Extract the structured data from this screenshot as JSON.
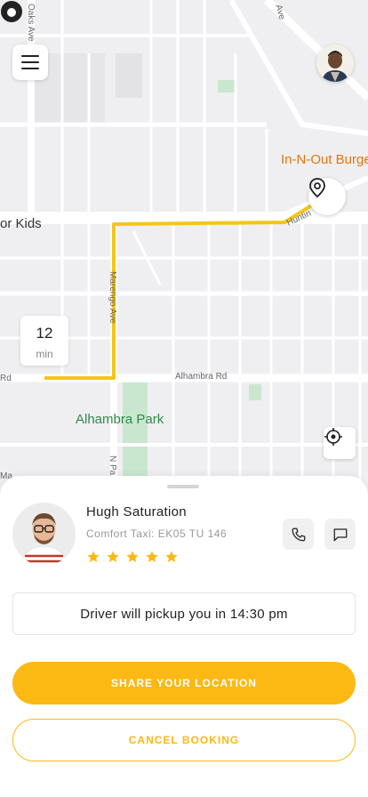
{
  "colors": {
    "accent": "#fdb913",
    "route": "#f5c518",
    "map_bg": "#efeff1",
    "park": "#c9e7cf"
  },
  "map": {
    "labels": {
      "street_oaks": "Oaks Ave",
      "street_ave": "Ave",
      "place_kids": "or Kids",
      "place_innout": "In-N-Out Burge",
      "street_hunt": "Huntin",
      "street_marengo": "Marengo Ave",
      "street_alhambra": "Alhambra Rd",
      "street_rd": "Rd",
      "park": "Alhambra Park",
      "street_np": "N Pa",
      "street_ma": "Ma"
    },
    "eta": {
      "value": "12",
      "unit": "min"
    },
    "menu_icon": "hamburger-menu-icon",
    "pin_icon": "location-pin-icon",
    "locate_icon": "crosshair-icon"
  },
  "driver": {
    "name": "Hugh Saturation",
    "vehicle": "Comfort Taxi: EK05 TU 146",
    "rating": 5,
    "call_icon": "phone-icon",
    "message_icon": "message-icon"
  },
  "pickup": {
    "text": "Driver will pickup you in 14:30 pm"
  },
  "actions": {
    "share_label": "SHARE YOUR LOCATION",
    "cancel_label": "CANCEL BOOKING"
  }
}
